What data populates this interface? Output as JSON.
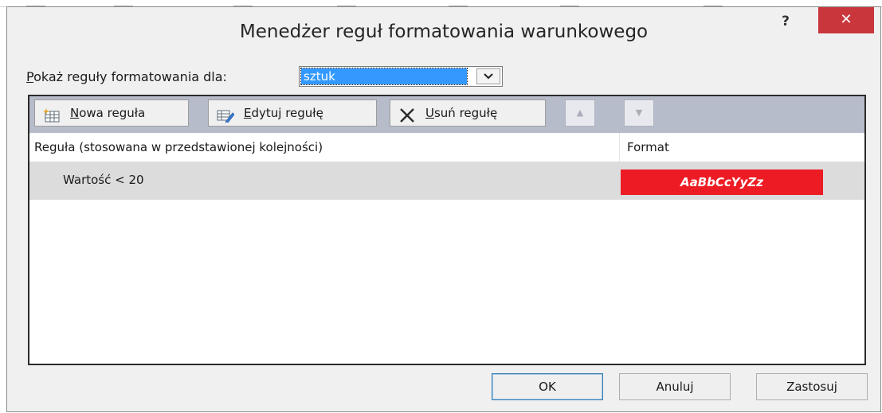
{
  "dialog": {
    "title": "Menedżer reguł formatowania warunkowego",
    "help_symbol": "?",
    "close_symbol": "✕"
  },
  "show_rules": {
    "label_accesskey": "P",
    "label_rest": "okaż reguły formatowania dla:",
    "selected": "sztuk"
  },
  "toolbar": {
    "new_rule": {
      "accesskey": "N",
      "rest": "owa reguła"
    },
    "edit_rule": {
      "accesskey": "E",
      "rest": "dytuj regułę"
    },
    "delete_rule": {
      "accesskey": "U",
      "rest": "suń regułę"
    },
    "move_up_symbol": "▲",
    "move_down_symbol": "▼"
  },
  "list": {
    "columns": [
      "Reguła (stosowana w przedstawionej kolejności)",
      "Format"
    ],
    "rules": [
      {
        "rule": "Wartość < 20",
        "format_preview": "AaBbCcYyZz",
        "format_color": "#ed1c24"
      }
    ]
  },
  "buttons": {
    "ok": "OK",
    "cancel": "Anuluj",
    "apply": "Zastosuj"
  }
}
